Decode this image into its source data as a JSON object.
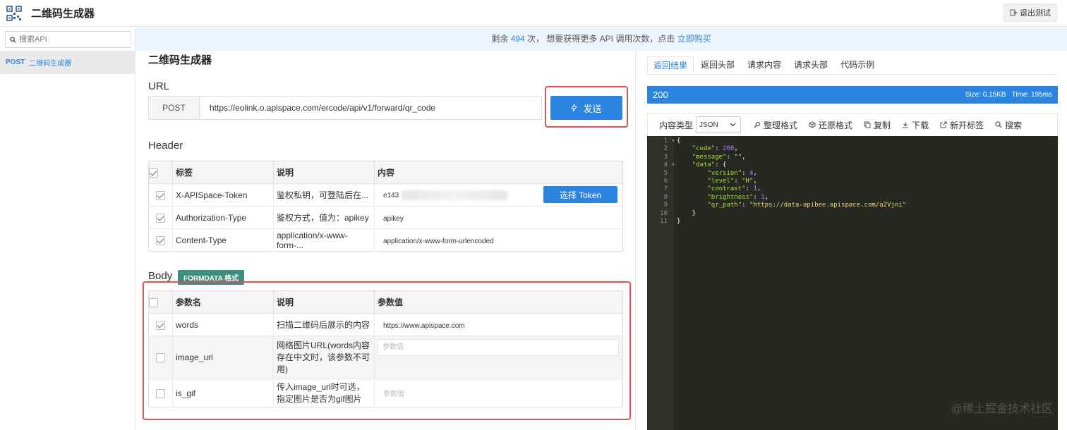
{
  "app": {
    "title": "二维码生成器",
    "exit_label": "退出测试"
  },
  "info_bar": {
    "prefix": "剩余 ",
    "remaining": "494",
    "middle": " 次， 想要获得更多 API 调用次数，点击 ",
    "link": "立即购买"
  },
  "sidebar": {
    "search_placeholder": "搜索API",
    "items": [
      {
        "method": "POST",
        "label": "二维码生成器"
      }
    ]
  },
  "main": {
    "title": "二维码生成器",
    "url_section": "URL",
    "method": "POST",
    "url": "https://eolink.o.apispace.com/ercode/api/v1/forward/qr_code",
    "send_label": "发送",
    "header_section": "Header",
    "header_columns": [
      "标签",
      "说明",
      "内容"
    ],
    "header_rows": [
      {
        "checked": true,
        "name": "X-APISpace-Token",
        "desc": "鉴权私钥，可登陆后在...",
        "value": "e143"
      },
      {
        "checked": true,
        "name": "Authorization-Type",
        "desc": "鉴权方式，值为：apikey",
        "value": "apikey"
      },
      {
        "checked": true,
        "name": "Content-Type",
        "desc": "application/x-www-form-...",
        "value": "application/x-www-form-urlencoded"
      }
    ],
    "token_button": "选择 Token",
    "body_section": "Body",
    "body_tag": "FORMDATA 格式",
    "body_columns": [
      "参数名",
      "说明",
      "参数值"
    ],
    "body_rows": [
      {
        "checked": true,
        "name": "words",
        "desc": "扫描二维码后展示的内容",
        "value": "https://www.apispace.com"
      },
      {
        "checked": false,
        "name": "image_url",
        "desc": "网络图片URL(words内容存在中文时，该参数不可用)",
        "placeholder": "参数值"
      },
      {
        "checked": false,
        "name": "is_gif",
        "desc": "传入image_url时可选，指定图片是否为gif图片",
        "placeholder": "参数值"
      }
    ]
  },
  "response": {
    "tabs": [
      "返回结果",
      "返回头部",
      "请求内容",
      "请求头部",
      "代码示例"
    ],
    "status": "200",
    "size_label": "Size:  0.15KB",
    "time_label": "Time:  195ms",
    "content_type_label": "内容类型",
    "content_type": "JSON",
    "tools": [
      "整理格式",
      "还原格式",
      "复制",
      "下载",
      "新开标签",
      "搜索"
    ],
    "code_lines": [
      "{",
      "    \"code\": 200,",
      "    \"message\": \"\",",
      "    \"data\": {",
      "        \"version\": 4,",
      "        \"level\": \"H\",",
      "        \"contrast\": 1,",
      "        \"brightness\": 1,",
      "        \"qr_path\": \"https://data-apibee.apispace.com/a2Vjni\"",
      "    }",
      "}"
    ]
  },
  "watermark": "@稀土掘金技术社区"
}
